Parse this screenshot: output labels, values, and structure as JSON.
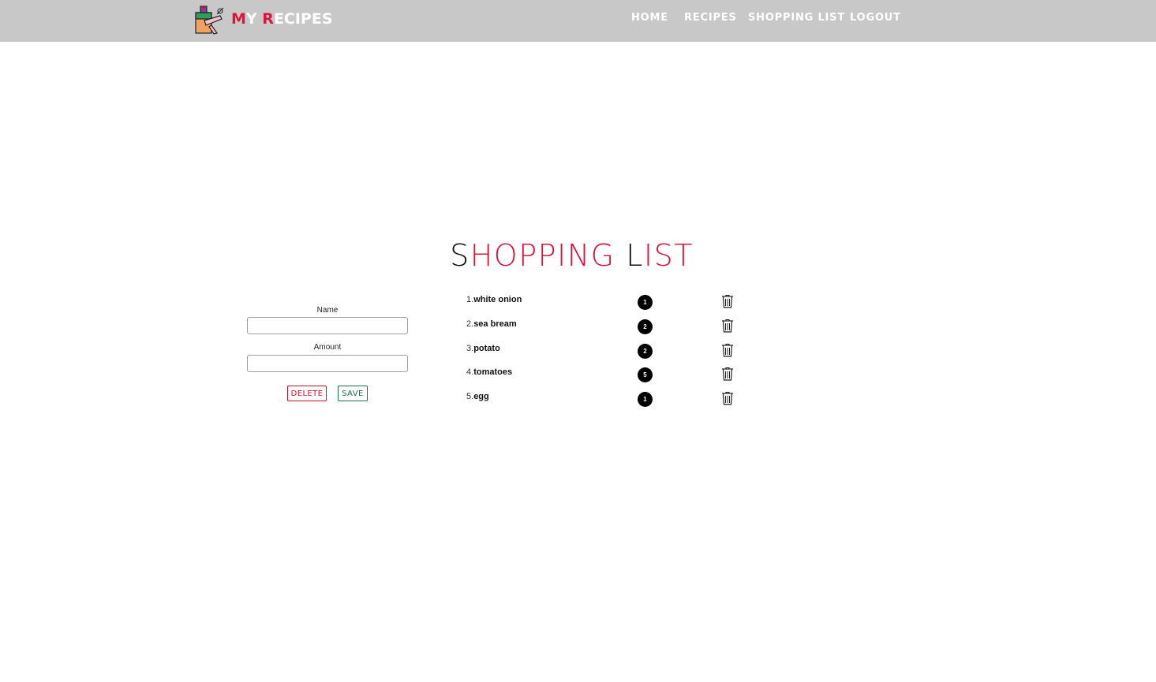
{
  "navbar": {
    "brand": {
      "m": "M",
      "y": "Y ",
      "r": "R",
      "rest": "ECIPES"
    },
    "items": [
      {
        "label": "HOME"
      },
      {
        "label": "RECIPES"
      },
      {
        "label": "SHOPPING LIST"
      },
      {
        "label": "LOGOUT"
      }
    ]
  },
  "title": {
    "s": "S",
    "hopping": "HOPPING ",
    "l": "L",
    "ist": "IST"
  },
  "form": {
    "name_label": "Name",
    "name_value": "",
    "amount_label": "Amount",
    "amount_value": "",
    "delete_label": "DELETE",
    "save_label": "SAVE"
  },
  "shopping_list": [
    {
      "num": "1.",
      "name": "white onion",
      "amount": "1"
    },
    {
      "num": "2.",
      "name": "sea bream",
      "amount": "2"
    },
    {
      "num": "3.",
      "name": "potato",
      "amount": "2"
    },
    {
      "num": "4.",
      "name": "tomatoes",
      "amount": "5"
    },
    {
      "num": "5.",
      "name": "egg",
      "amount": "1"
    }
  ],
  "icons": {
    "logo": "chef-logo-icon",
    "delete_item": "trash-icon"
  },
  "colors": {
    "navbar_bg": "#c8c8c8",
    "accent_red": "#dc143c",
    "save_green": "#1c6e4a",
    "badge_bg": "#000000"
  }
}
